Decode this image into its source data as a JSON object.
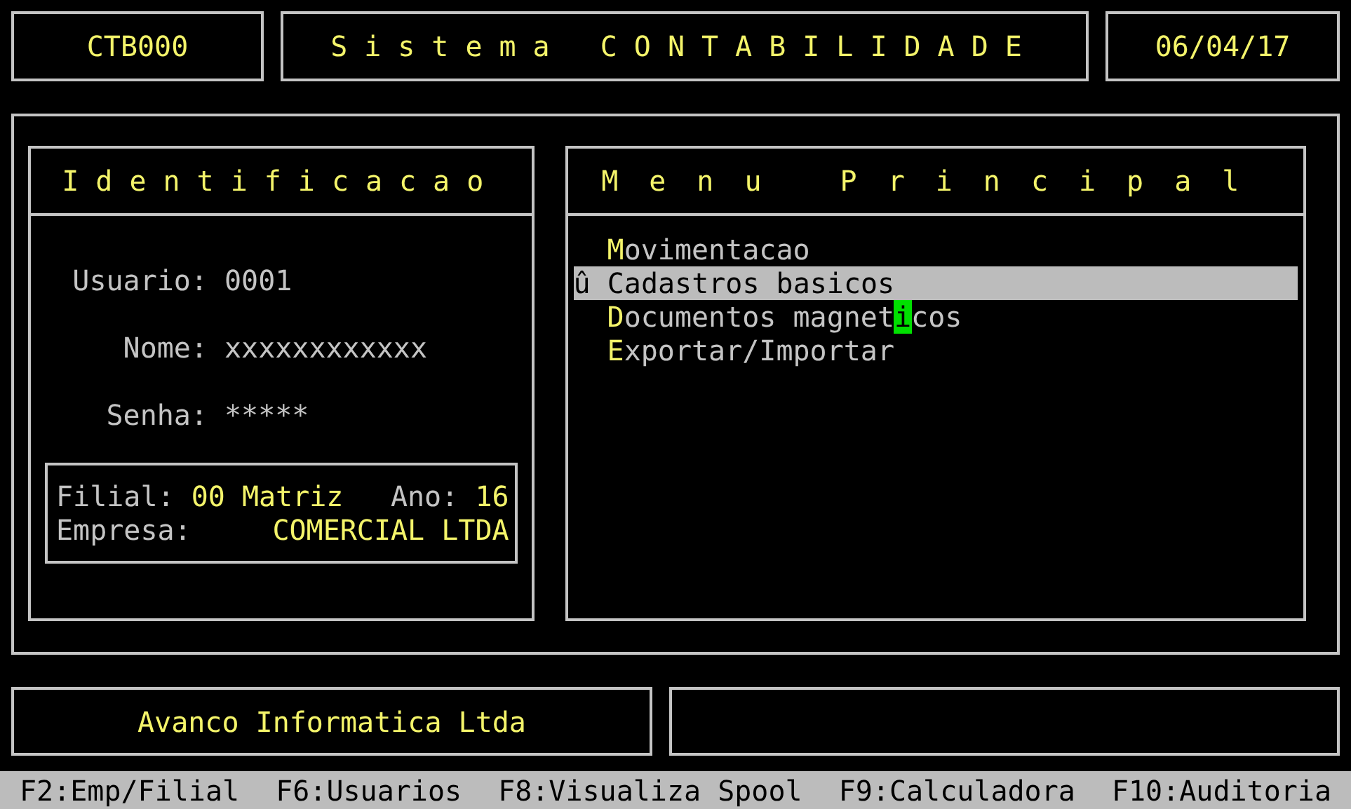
{
  "header": {
    "code": "CTB000",
    "title": "Sistema CONTABILIDADE",
    "date": "06/04/17"
  },
  "identification": {
    "title": "Identificacao",
    "fields": [
      {
        "label": "Usuario:",
        "value": "0001"
      },
      {
        "label": "Nome:",
        "value": "xxxxxxxxxxxx"
      },
      {
        "label": "Senha:",
        "value": "*****"
      }
    ],
    "company": {
      "branch_label": "Filial:",
      "branch": "00 Matriz",
      "year_label": "Ano:",
      "year": "16",
      "company_label": "Empresa:",
      "company": "COMERCIAL LTDA"
    }
  },
  "menu": {
    "title": "Menu Principal",
    "items": [
      {
        "hotkey": "M",
        "label": "ovimentacao",
        "selected": false
      },
      {
        "marker": "û",
        "hotkey": "C",
        "label": "adastros basicos",
        "selected": true
      },
      {
        "hotkey": "D",
        "label": "ocumentos magnet",
        "cursor": "i",
        "label_end": "cos",
        "selected": false
      },
      {
        "hotkey": "E",
        "label": "xportar/Importar",
        "selected": false
      }
    ]
  },
  "footer": {
    "vendor": "Avanco Informatica Ltda"
  },
  "status_bar": [
    "F2:Emp/Filial",
    "F6:Usuarios",
    "F8:Visualiza Spool",
    "F9:Calculadora",
    "F10:Auditoria"
  ]
}
